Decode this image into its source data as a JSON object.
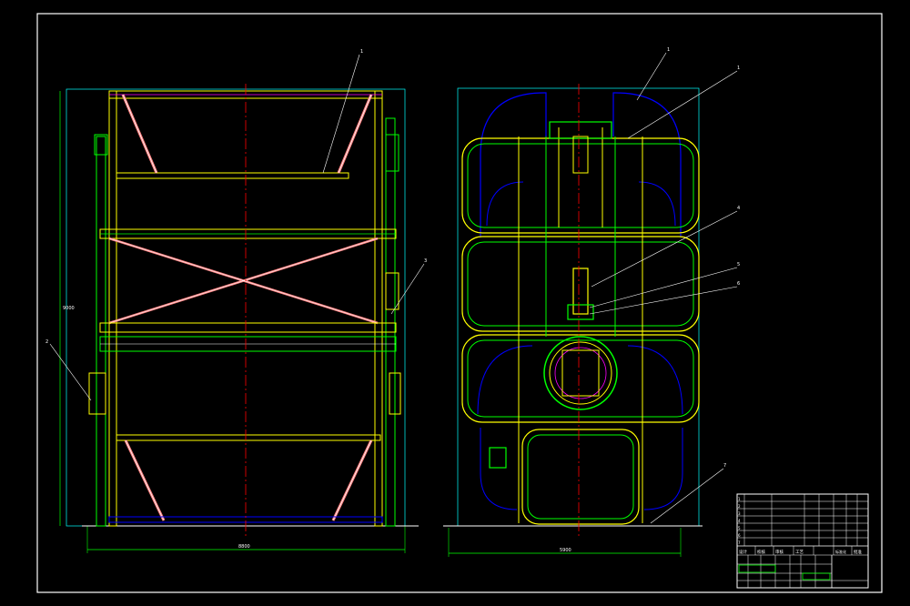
{
  "drawing": {
    "background": "#000000",
    "colors": {
      "frame": "#ffffff",
      "green": "#00ff00",
      "yellow": "#ffff00",
      "red": "#ff0000",
      "blue": "#0000ff",
      "cyan": "#00ffff",
      "magenta": "#ff00ff",
      "pink": "#ff8080"
    },
    "left_view": {
      "overall_width_dim": "8800",
      "overall_height_dim": "9000",
      "callouts": [
        "1",
        "2",
        "3"
      ]
    },
    "right_view": {
      "overall_width_dim": "5900",
      "callouts": [
        "1",
        "1",
        "4",
        "5",
        "6",
        "7"
      ]
    },
    "title_block": {
      "rows": [
        "1",
        "2",
        "3",
        "4",
        "5",
        "6",
        "7"
      ],
      "bottom_labels": [
        "设计",
        "校核",
        "审核",
        "工艺",
        "标准化",
        "批准"
      ]
    }
  }
}
